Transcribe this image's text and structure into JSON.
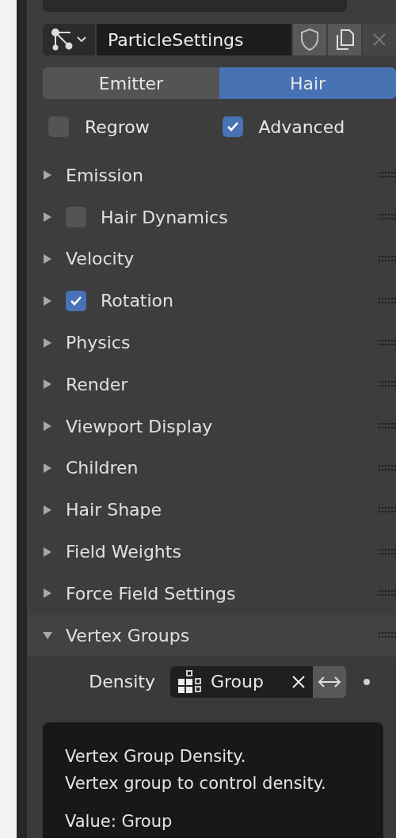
{
  "datablock": {
    "name": "ParticleSettings"
  },
  "tabs": [
    {
      "label": "Emitter",
      "selected": false
    },
    {
      "label": "Hair",
      "selected": true
    }
  ],
  "options": [
    {
      "label": "Regrow",
      "checked": false
    },
    {
      "label": "Advanced",
      "checked": true
    }
  ],
  "panels": [
    {
      "label": "Emission",
      "kind": "plain",
      "expanded": false
    },
    {
      "label": "Hair Dynamics",
      "kind": "checkbox",
      "checked": false,
      "expanded": false
    },
    {
      "label": "Velocity",
      "kind": "plain",
      "expanded": false
    },
    {
      "label": "Rotation",
      "kind": "checkbox",
      "checked": true,
      "expanded": false
    },
    {
      "label": "Physics",
      "kind": "plain",
      "expanded": false
    },
    {
      "label": "Render",
      "kind": "plain",
      "expanded": false
    },
    {
      "label": "Viewport Display",
      "kind": "plain",
      "expanded": false
    },
    {
      "label": "Children",
      "kind": "plain",
      "expanded": false
    },
    {
      "label": "Hair Shape",
      "kind": "plain",
      "expanded": false
    },
    {
      "label": "Field Weights",
      "kind": "plain",
      "expanded": false
    },
    {
      "label": "Force Field Settings",
      "kind": "plain",
      "expanded": false
    },
    {
      "label": "Vertex Groups",
      "kind": "plain",
      "expanded": true
    }
  ],
  "vertex_groups": [
    {
      "label": "Density",
      "value": "Group"
    }
  ],
  "tooltip": {
    "title": "Vertex Group Density.",
    "description": "Vertex group to control density.",
    "value": "Value: Group"
  }
}
